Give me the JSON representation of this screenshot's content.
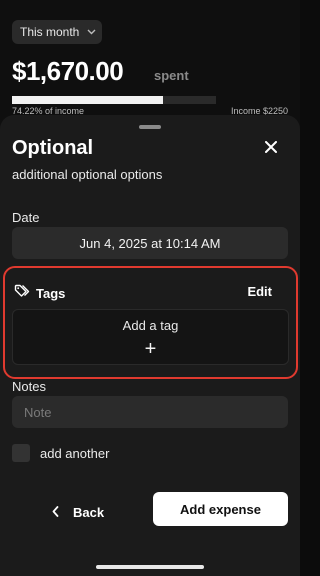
{
  "summary": {
    "period": "This month",
    "amount": "$1,670.00",
    "spent_label": "spent",
    "progress_fraction": 0.7422,
    "percent_text": "74.22% of income",
    "income_text": "Income $2250"
  },
  "sheet": {
    "title": "Optional",
    "subtitle": "additional optional options",
    "date_label": "Date",
    "date_value": "Jun 4, 2025 at 10:14 AM",
    "tags_label": "Tags",
    "edit_label": "Edit",
    "add_tag_label": "Add a tag",
    "add_tag_plus": "+",
    "notes_label": "Notes",
    "notes_placeholder": "Note",
    "add_another_label": "add another",
    "back_label": "Back",
    "add_expense_label": "Add expense"
  },
  "colors": {
    "highlight": "#e03a2f",
    "primary_button_bg": "#ffffff",
    "sheet_bg": "#1b1b1b"
  },
  "icons": {
    "period_dropdown": "chevron-down-icon",
    "close": "close-icon",
    "tags": "tag-icon",
    "back": "chevron-left-icon",
    "add": "plus-icon"
  }
}
